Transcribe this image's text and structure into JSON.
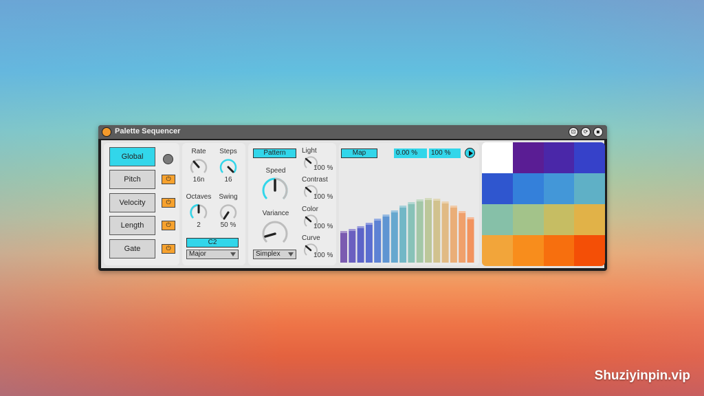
{
  "window": {
    "title": "Palette Sequencer",
    "icons": [
      "fit-icon",
      "loop-icon",
      "save-icon"
    ]
  },
  "lanes": {
    "items": [
      {
        "label": "Global",
        "active": true
      },
      {
        "label": "Pitch",
        "active": false
      },
      {
        "label": "Velocity",
        "active": false
      },
      {
        "label": "Length",
        "active": false
      },
      {
        "label": "Gate",
        "active": false
      }
    ]
  },
  "clock": {
    "rate_label": "Rate",
    "rate_value": "16n",
    "steps_label": "Steps",
    "steps_value": "16",
    "octaves_label": "Octaves",
    "octaves_value": "2",
    "swing_label": "Swing",
    "swing_value": "50 %",
    "root_value": "C2",
    "scale_value": "Major"
  },
  "pattern": {
    "button_label": "Pattern",
    "speed_label": "Speed",
    "variance_label": "Variance",
    "noise_value": "Simplex",
    "light_label": "Light",
    "light_value": "100 %",
    "contrast_label": "Contrast",
    "contrast_value": "100 %",
    "color_label": "Color",
    "color_value": "100 %",
    "curve_label": "Curve",
    "curve_value": "100 %"
  },
  "map": {
    "button_label": "Map",
    "range_min": "0.00 %",
    "range_max": "100 %",
    "bars": [
      {
        "value": 0.46,
        "color": "#7b5bb0"
      },
      {
        "value": 0.49,
        "color": "#6a5fc0"
      },
      {
        "value": 0.53,
        "color": "#5c63c8"
      },
      {
        "value": 0.58,
        "color": "#5a6dd0"
      },
      {
        "value": 0.64,
        "color": "#5d82d4"
      },
      {
        "value": 0.7,
        "color": "#5f95d2"
      },
      {
        "value": 0.76,
        "color": "#66a8cf"
      },
      {
        "value": 0.83,
        "color": "#72b7c6"
      },
      {
        "value": 0.88,
        "color": "#88c2b8"
      },
      {
        "value": 0.92,
        "color": "#a3c7a7"
      },
      {
        "value": 0.94,
        "color": "#bcc79a"
      },
      {
        "value": 0.93,
        "color": "#d1c28e"
      },
      {
        "value": 0.89,
        "color": "#e1ba84"
      },
      {
        "value": 0.83,
        "color": "#eaae78"
      },
      {
        "value": 0.75,
        "color": "#f0a06b"
      },
      {
        "value": 0.66,
        "color": "#f2935e"
      }
    ]
  },
  "palette": {
    "colors": [
      "#ffffff",
      "#5a1d94",
      "#4a27a8",
      "#3641c9",
      "#2f56cf",
      "#3480da",
      "#4397d8",
      "#5fb0c6",
      "#86c0a8",
      "#a3c38a",
      "#c6bd63",
      "#e1b248",
      "#f2a53a",
      "#f88d1c",
      "#f76f0e",
      "#f44f06"
    ]
  },
  "watermark": "Shuziyinpin.vip"
}
